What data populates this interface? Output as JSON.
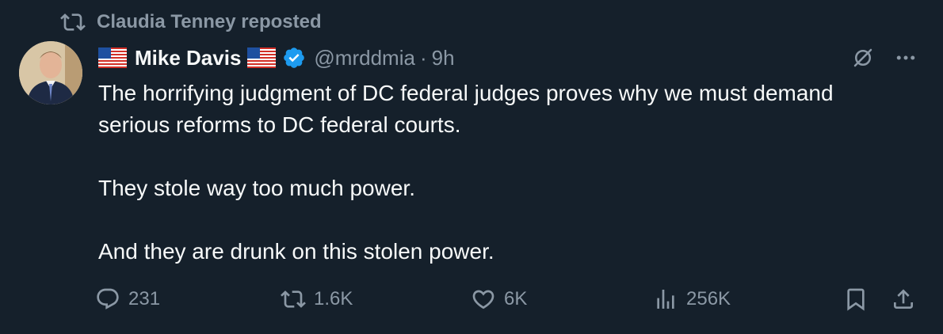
{
  "repost": {
    "label": "Claudia Tenney reposted"
  },
  "author": {
    "name": "Mike Davis",
    "handle": "@mrddmia",
    "separator": "·",
    "time": "9h",
    "flag_icon": "us-flag-icon",
    "verified_color": "#1d9bf0"
  },
  "tweet": {
    "lines": [
      "The horrifying judgment of DC federal judges proves why we must demand",
      "serious reforms to DC federal courts.",
      "They stole way too much power.",
      "And they are drunk on this stolen power."
    ]
  },
  "actions": {
    "replies": "231",
    "reposts": "1.6K",
    "likes": "6K",
    "views": "256K"
  },
  "colors": {
    "background": "#15202b",
    "text": "#f7f9f9",
    "muted": "#8b98a5",
    "accent": "#1d9bf0"
  }
}
